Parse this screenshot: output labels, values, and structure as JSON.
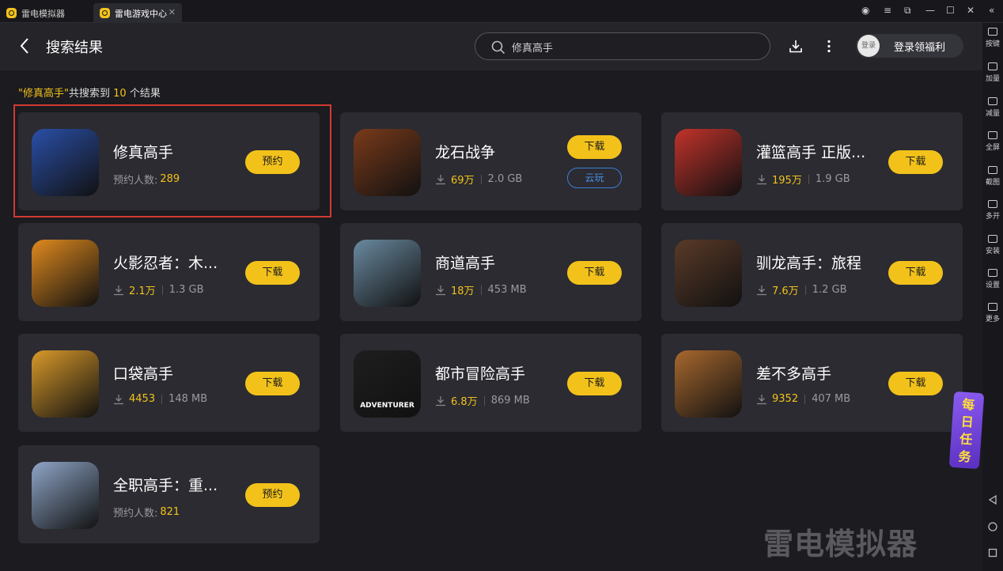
{
  "titlebar": {
    "tabs": [
      {
        "label": "雷电模拟器"
      },
      {
        "label": "雷电游戏中心"
      }
    ]
  },
  "header": {
    "title": "搜索结果",
    "search_value": "修真高手",
    "login_avatar": "登录",
    "login_label": "登录领福利"
  },
  "result_line": {
    "query_quoted": "\"修真高手\"",
    "prefix": "共搜索到",
    "count": "10",
    "suffix": "个结果"
  },
  "cards": [
    {
      "name": "修真高手",
      "meta_label": "预约人数:",
      "meta_value": "289",
      "size": "",
      "button": "预约",
      "cloud": "",
      "icon_color": "#2a4fa8"
    },
    {
      "name": "龙石战争",
      "meta_label": "",
      "meta_value": "69万",
      "size": "2.0 GB",
      "button": "下载",
      "cloud": "云玩",
      "icon_color": "#7a3a1a"
    },
    {
      "name": "灌篮高手 正版...",
      "meta_label": "",
      "meta_value": "195万",
      "size": "1.9 GB",
      "button": "下载",
      "cloud": "",
      "icon_color": "#c2332b"
    },
    {
      "name": "火影忍者：木...",
      "meta_label": "",
      "meta_value": "2.1万",
      "size": "1.3 GB",
      "button": "下载",
      "cloud": "",
      "icon_color": "#e08a1e"
    },
    {
      "name": "商道高手",
      "meta_label": "",
      "meta_value": "18万",
      "size": "453 MB",
      "button": "下载",
      "cloud": "",
      "icon_color": "#6a8aa0"
    },
    {
      "name": "驯龙高手：旅程",
      "meta_label": "",
      "meta_value": "7.6万",
      "size": "1.2 GB",
      "button": "下载",
      "cloud": "",
      "icon_color": "#5a3a28"
    },
    {
      "name": "口袋高手",
      "meta_label": "",
      "meta_value": "4453",
      "size": "148 MB",
      "button": "下载",
      "cloud": "",
      "icon_color": "#d99a2a"
    },
    {
      "name": "都市冒险高手",
      "meta_label": "",
      "meta_value": "6.8万",
      "size": "869 MB",
      "button": "下载",
      "cloud": "",
      "icon_color": "#1e1e1e",
      "icon_text": "ADVENTURER"
    },
    {
      "name": "差不多高手",
      "meta_label": "",
      "meta_value": "9352",
      "size": "407 MB",
      "button": "下载",
      "cloud": "",
      "icon_color": "#a8682e"
    },
    {
      "name": "全职高手：重...",
      "meta_label": "预约人数:",
      "meta_value": "821",
      "size": "",
      "button": "预约",
      "cloud": "",
      "icon_color": "#8fa6c8"
    }
  ],
  "sidebar": {
    "items": [
      "按键",
      "加量",
      "减量",
      "全屏",
      "截图",
      "多开",
      "安装",
      "设置",
      "更多"
    ]
  },
  "daily_task": [
    "每",
    "日",
    "任",
    "务"
  ],
  "watermark": "雷电模拟器"
}
